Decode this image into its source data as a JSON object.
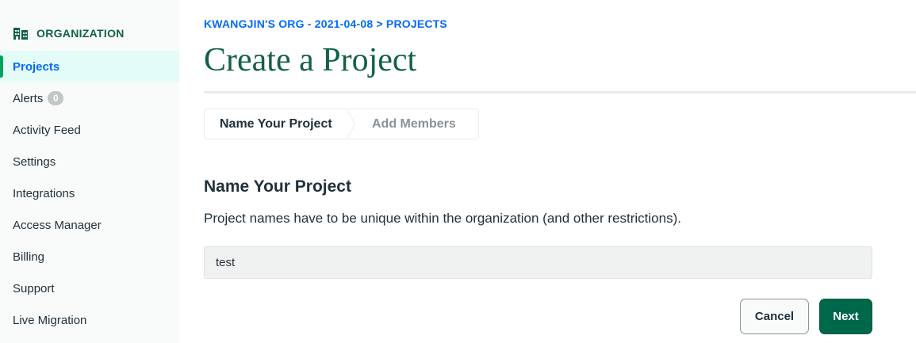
{
  "sidebar": {
    "org_label": "ORGANIZATION",
    "org_icon": "building-icon",
    "items": [
      {
        "label": "Projects",
        "active": true
      },
      {
        "label": "Alerts",
        "badge": "0"
      },
      {
        "label": "Activity Feed"
      },
      {
        "label": "Settings"
      },
      {
        "label": "Integrations"
      },
      {
        "label": "Access Manager"
      },
      {
        "label": "Billing"
      },
      {
        "label": "Support"
      },
      {
        "label": "Live Migration"
      }
    ]
  },
  "header": {
    "breadcrumb": "KWANGJIN'S ORG - 2021-04-08 > PROJECTS",
    "title": "Create a Project"
  },
  "stepper": {
    "steps": [
      {
        "label": "Name Your Project",
        "active": true
      },
      {
        "label": "Add Members",
        "active": false
      }
    ]
  },
  "form": {
    "section_title": "Name Your Project",
    "description": "Project names have to be unique within the organization (and other restrictions).",
    "project_name_value": "test"
  },
  "actions": {
    "cancel_label": "Cancel",
    "next_label": "Next"
  },
  "colors": {
    "brand_green": "#116149",
    "primary_button": "#00684a",
    "link_blue": "#016bf8",
    "active_nav_bg": "#e3fcf7"
  }
}
